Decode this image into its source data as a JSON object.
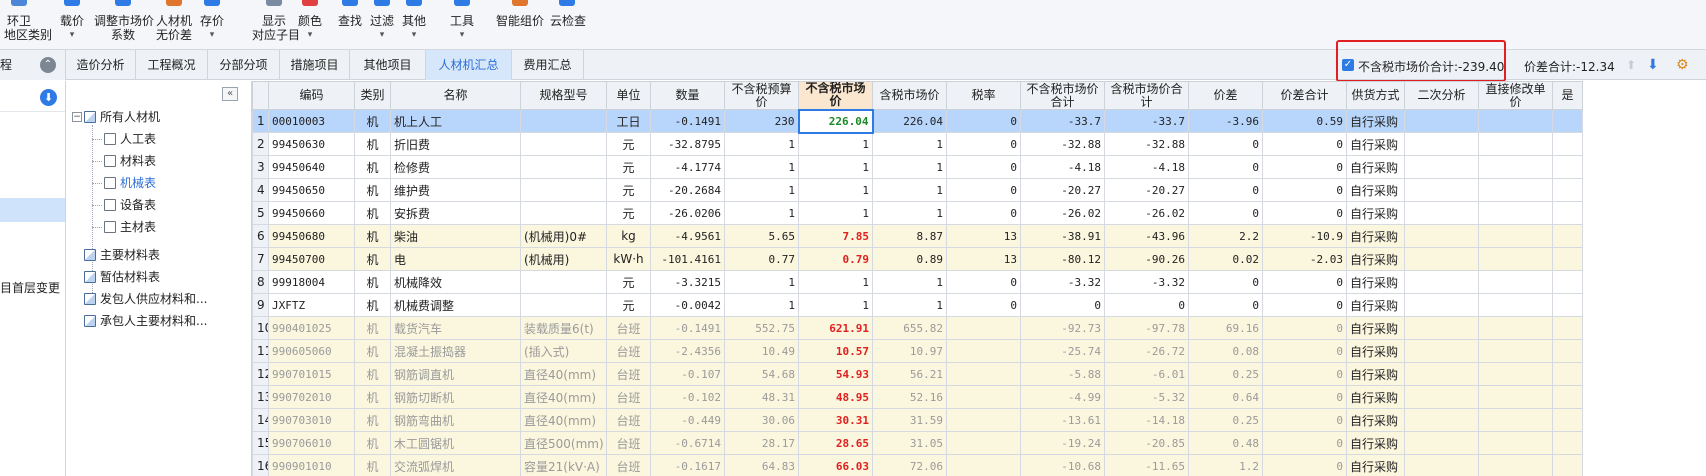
{
  "toolbar": {
    "items": [
      {
        "label": "环卫",
        "sub": "地区类别",
        "icon": "region-icon",
        "color": "#4c86d9"
      },
      {
        "label": "载价",
        "sub": "▾",
        "icon": "load-price-icon",
        "color": "#2f7be5"
      },
      {
        "label": "调整市场价",
        "sub": "系数",
        "icon": "adjust-price-icon",
        "color": "#2f7be5"
      },
      {
        "label": "人材机",
        "sub": "无价差",
        "icon": "no-diff-icon",
        "color": "#e0752d"
      },
      {
        "label": "存价",
        "sub": "▾",
        "icon": "save-price-icon",
        "color": "#2f7be5"
      },
      {
        "label": "显示",
        "sub": "对应子目",
        "icon": "display-icon",
        "color": "#7a8aa0"
      },
      {
        "label": "颜色",
        "sub": "▾",
        "icon": "color-icon",
        "color": "#e04040"
      },
      {
        "label": "查找",
        "sub": "",
        "icon": "find-icon",
        "color": "#2f7be5"
      },
      {
        "label": "过滤",
        "sub": "▾",
        "icon": "filter-icon",
        "color": "#2f7be5"
      },
      {
        "label": "其他",
        "sub": "▾",
        "icon": "other-icon",
        "color": "#2f7be5"
      },
      {
        "label": "工具",
        "sub": "▾",
        "icon": "tool-icon",
        "color": "#2f7be5"
      },
      {
        "label": "智能组价",
        "sub": "",
        "icon": "smart-price-icon",
        "color": "#e0752d"
      },
      {
        "label": "云检查",
        "sub": "",
        "icon": "cloud-check-icon",
        "color": "#2f7be5"
      }
    ]
  },
  "side_title": "程",
  "tabs": [
    {
      "label": "造价分析",
      "active": false
    },
    {
      "label": "工程概况",
      "active": false
    },
    {
      "label": "分部分项",
      "active": false
    },
    {
      "label": "措施项目",
      "active": false
    },
    {
      "label": "其他项目",
      "active": false
    },
    {
      "label": "人材机汇总",
      "active": true
    },
    {
      "label": "费用汇总",
      "active": false
    }
  ],
  "summary": {
    "checkbox_checked": true,
    "excl_tax_total": "不含税市场价合计:-239.40",
    "diff_total": "价差合计:-12.34"
  },
  "left_panel": {
    "item": "目首层变更"
  },
  "tree": {
    "root": "所有人材机",
    "children": [
      "人工表",
      "材料表",
      "机械表",
      "设备表",
      "主材表"
    ],
    "selected": "机械表",
    "others": [
      "主要材料表",
      "暂估材料表",
      "发包人供应材料和...",
      "承包人主要材料和..."
    ]
  },
  "grid": {
    "columns": [
      "",
      "编码",
      "类别",
      "名称",
      "规格型号",
      "单位",
      "数量",
      "不含税预算价",
      "不含税市场价",
      "含税市场价",
      "税率",
      "不含税市场价合计",
      "含税市场价合计",
      "价差",
      "价差合计",
      "供货方式",
      "二次分析",
      "直接修改单价",
      "是"
    ],
    "rows": [
      [
        "1",
        "00010003",
        "机",
        "机上人工",
        "",
        "工日",
        "-0.1491",
        "230",
        "226.04",
        "226.04",
        "0",
        "-33.7",
        "-33.7",
        "-3.96",
        "0.59",
        "自行采购",
        "",
        "",
        ""
      ],
      [
        "2",
        "99450630",
        "机",
        "折旧费",
        "",
        "元",
        "-32.8795",
        "1",
        "1",
        "1",
        "0",
        "-32.88",
        "-32.88",
        "0",
        "0",
        "自行采购",
        "",
        "",
        ""
      ],
      [
        "3",
        "99450640",
        "机",
        "检修费",
        "",
        "元",
        "-4.1774",
        "1",
        "1",
        "1",
        "0",
        "-4.18",
        "-4.18",
        "0",
        "0",
        "自行采购",
        "",
        "",
        ""
      ],
      [
        "4",
        "99450650",
        "机",
        "维护费",
        "",
        "元",
        "-20.2684",
        "1",
        "1",
        "1",
        "0",
        "-20.27",
        "-20.27",
        "0",
        "0",
        "自行采购",
        "",
        "",
        ""
      ],
      [
        "5",
        "99450660",
        "机",
        "安拆费",
        "",
        "元",
        "-26.0206",
        "1",
        "1",
        "1",
        "0",
        "-26.02",
        "-26.02",
        "0",
        "0",
        "自行采购",
        "",
        "",
        ""
      ],
      [
        "6",
        "99450680",
        "机",
        "柴油",
        "(机械用)0#",
        "kg",
        "-4.9561",
        "5.65",
        "7.85",
        "8.87",
        "13",
        "-38.91",
        "-43.96",
        "2.2",
        "-10.9",
        "自行采购",
        "",
        "",
        ""
      ],
      [
        "7",
        "99450700",
        "机",
        "电",
        "(机械用)",
        "kW·h",
        "-101.4161",
        "0.77",
        "0.79",
        "0.89",
        "13",
        "-80.12",
        "-90.26",
        "0.02",
        "-2.03",
        "自行采购",
        "",
        "",
        ""
      ],
      [
        "8",
        "99918004",
        "机",
        "机械降效",
        "",
        "元",
        "-3.3215",
        "1",
        "1",
        "1",
        "0",
        "-3.32",
        "-3.32",
        "0",
        "0",
        "自行采购",
        "",
        "",
        ""
      ],
      [
        "9",
        "JXFTZ",
        "机",
        "机械费调整",
        "",
        "元",
        "-0.0042",
        "1",
        "1",
        "1",
        "0",
        "0",
        "0",
        "0",
        "0",
        "自行采购",
        "",
        "",
        ""
      ],
      [
        "10",
        "990401025",
        "机",
        "载货汽车",
        "装载质量6(t)",
        "台班",
        "-0.1491",
        "552.75",
        "621.91",
        "655.82",
        "",
        "-92.73",
        "-97.78",
        "69.16",
        "0",
        "自行采购",
        "",
        "",
        ""
      ],
      [
        "11",
        "990605060",
        "机",
        "混凝土振捣器",
        "(插入式)",
        "台班",
        "-2.4356",
        "10.49",
        "10.57",
        "10.97",
        "",
        "-25.74",
        "-26.72",
        "0.08",
        "0",
        "自行采购",
        "",
        "",
        ""
      ],
      [
        "12",
        "990701015",
        "机",
        "钢筋调直机",
        "直径40(mm)",
        "台班",
        "-0.107",
        "54.68",
        "54.93",
        "56.21",
        "",
        "-5.88",
        "-6.01",
        "0.25",
        "0",
        "自行采购",
        "",
        "",
        ""
      ],
      [
        "13",
        "990702010",
        "机",
        "钢筋切断机",
        "直径40(mm)",
        "台班",
        "-0.102",
        "48.31",
        "48.95",
        "52.16",
        "",
        "-4.99",
        "-5.32",
        "0.64",
        "0",
        "自行采购",
        "",
        "",
        ""
      ],
      [
        "14",
        "990703010",
        "机",
        "钢筋弯曲机",
        "直径40(mm)",
        "台班",
        "-0.449",
        "30.06",
        "30.31",
        "31.59",
        "",
        "-13.61",
        "-14.18",
        "0.25",
        "0",
        "自行采购",
        "",
        "",
        ""
      ],
      [
        "15",
        "990706010",
        "机",
        "木工圆锯机",
        "直径500(mm)",
        "台班",
        "-0.6714",
        "28.17",
        "28.65",
        "31.05",
        "",
        "-19.24",
        "-20.85",
        "0.48",
        "0",
        "自行采购",
        "",
        "",
        ""
      ],
      [
        "16",
        "990901010",
        "机",
        "交流弧焊机",
        "容量21(kV·A)",
        "台班",
        "-0.1617",
        "64.83",
        "66.03",
        "72.06",
        "",
        "-10.68",
        "-11.65",
        "1.2",
        "0",
        "自行采购",
        "",
        "",
        ""
      ]
    ],
    "row_styles": [
      "sel",
      "plain",
      "plain",
      "plain",
      "plain",
      "yel",
      "yel",
      "plain",
      "plain",
      "gray",
      "gray",
      "gray",
      "gray",
      "gray",
      "gray",
      "gray"
    ]
  }
}
